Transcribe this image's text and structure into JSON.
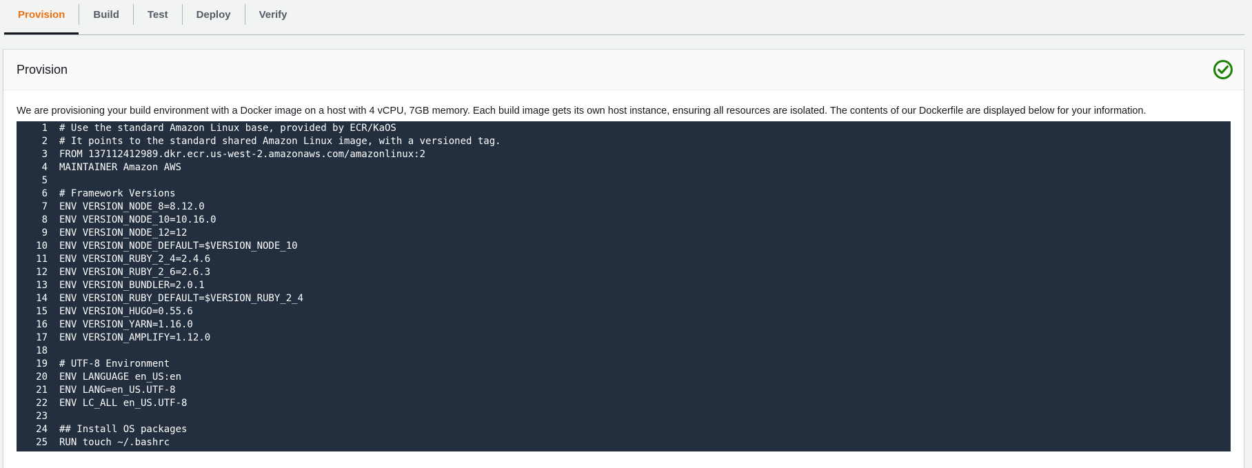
{
  "tabs": [
    {
      "label": "Provision",
      "active": true
    },
    {
      "label": "Build",
      "active": false
    },
    {
      "label": "Test",
      "active": false
    },
    {
      "label": "Deploy",
      "active": false
    },
    {
      "label": "Verify",
      "active": false
    }
  ],
  "panel": {
    "title": "Provision",
    "status_icon": "check-circle-icon",
    "status_color": "#1d8102",
    "description": "We are provisioning your build environment with a Docker image on a host with 4 vCPU, 7GB memory. Each build image gets its own host instance, ensuring all resources are isolated. The contents of our Dockerfile are displayed below for your information."
  },
  "code": {
    "lines": [
      {
        "n": "1",
        "t": "# Use the standard Amazon Linux base, provided by ECR/KaOS"
      },
      {
        "n": "2",
        "t": "# It points to the standard shared Amazon Linux image, with a versioned tag."
      },
      {
        "n": "3",
        "t": "FROM 137112412989.dkr.ecr.us-west-2.amazonaws.com/amazonlinux:2"
      },
      {
        "n": "4",
        "t": "MAINTAINER Amazon AWS"
      },
      {
        "n": "5",
        "t": ""
      },
      {
        "n": "6",
        "t": "# Framework Versions"
      },
      {
        "n": "7",
        "t": "ENV VERSION_NODE_8=8.12.0"
      },
      {
        "n": "8",
        "t": "ENV VERSION_NODE_10=10.16.0"
      },
      {
        "n": "9",
        "t": "ENV VERSION_NODE_12=12"
      },
      {
        "n": "10",
        "t": "ENV VERSION_NODE_DEFAULT=$VERSION_NODE_10"
      },
      {
        "n": "11",
        "t": "ENV VERSION_RUBY_2_4=2.4.6"
      },
      {
        "n": "12",
        "t": "ENV VERSION_RUBY_2_6=2.6.3"
      },
      {
        "n": "13",
        "t": "ENV VERSION_BUNDLER=2.0.1"
      },
      {
        "n": "14",
        "t": "ENV VERSION_RUBY_DEFAULT=$VERSION_RUBY_2_4"
      },
      {
        "n": "15",
        "t": "ENV VERSION_HUGO=0.55.6"
      },
      {
        "n": "16",
        "t": "ENV VERSION_YARN=1.16.0"
      },
      {
        "n": "17",
        "t": "ENV VERSION_AMPLIFY=1.12.0"
      },
      {
        "n": "18",
        "t": ""
      },
      {
        "n": "19",
        "t": "# UTF-8 Environment"
      },
      {
        "n": "20",
        "t": "ENV LANGUAGE en_US:en"
      },
      {
        "n": "21",
        "t": "ENV LANG=en_US.UTF-8"
      },
      {
        "n": "22",
        "t": "ENV LC_ALL en_US.UTF-8"
      },
      {
        "n": "23",
        "t": ""
      },
      {
        "n": "24",
        "t": "## Install OS packages"
      },
      {
        "n": "25",
        "t": "RUN touch ~/.bashrc"
      }
    ]
  }
}
